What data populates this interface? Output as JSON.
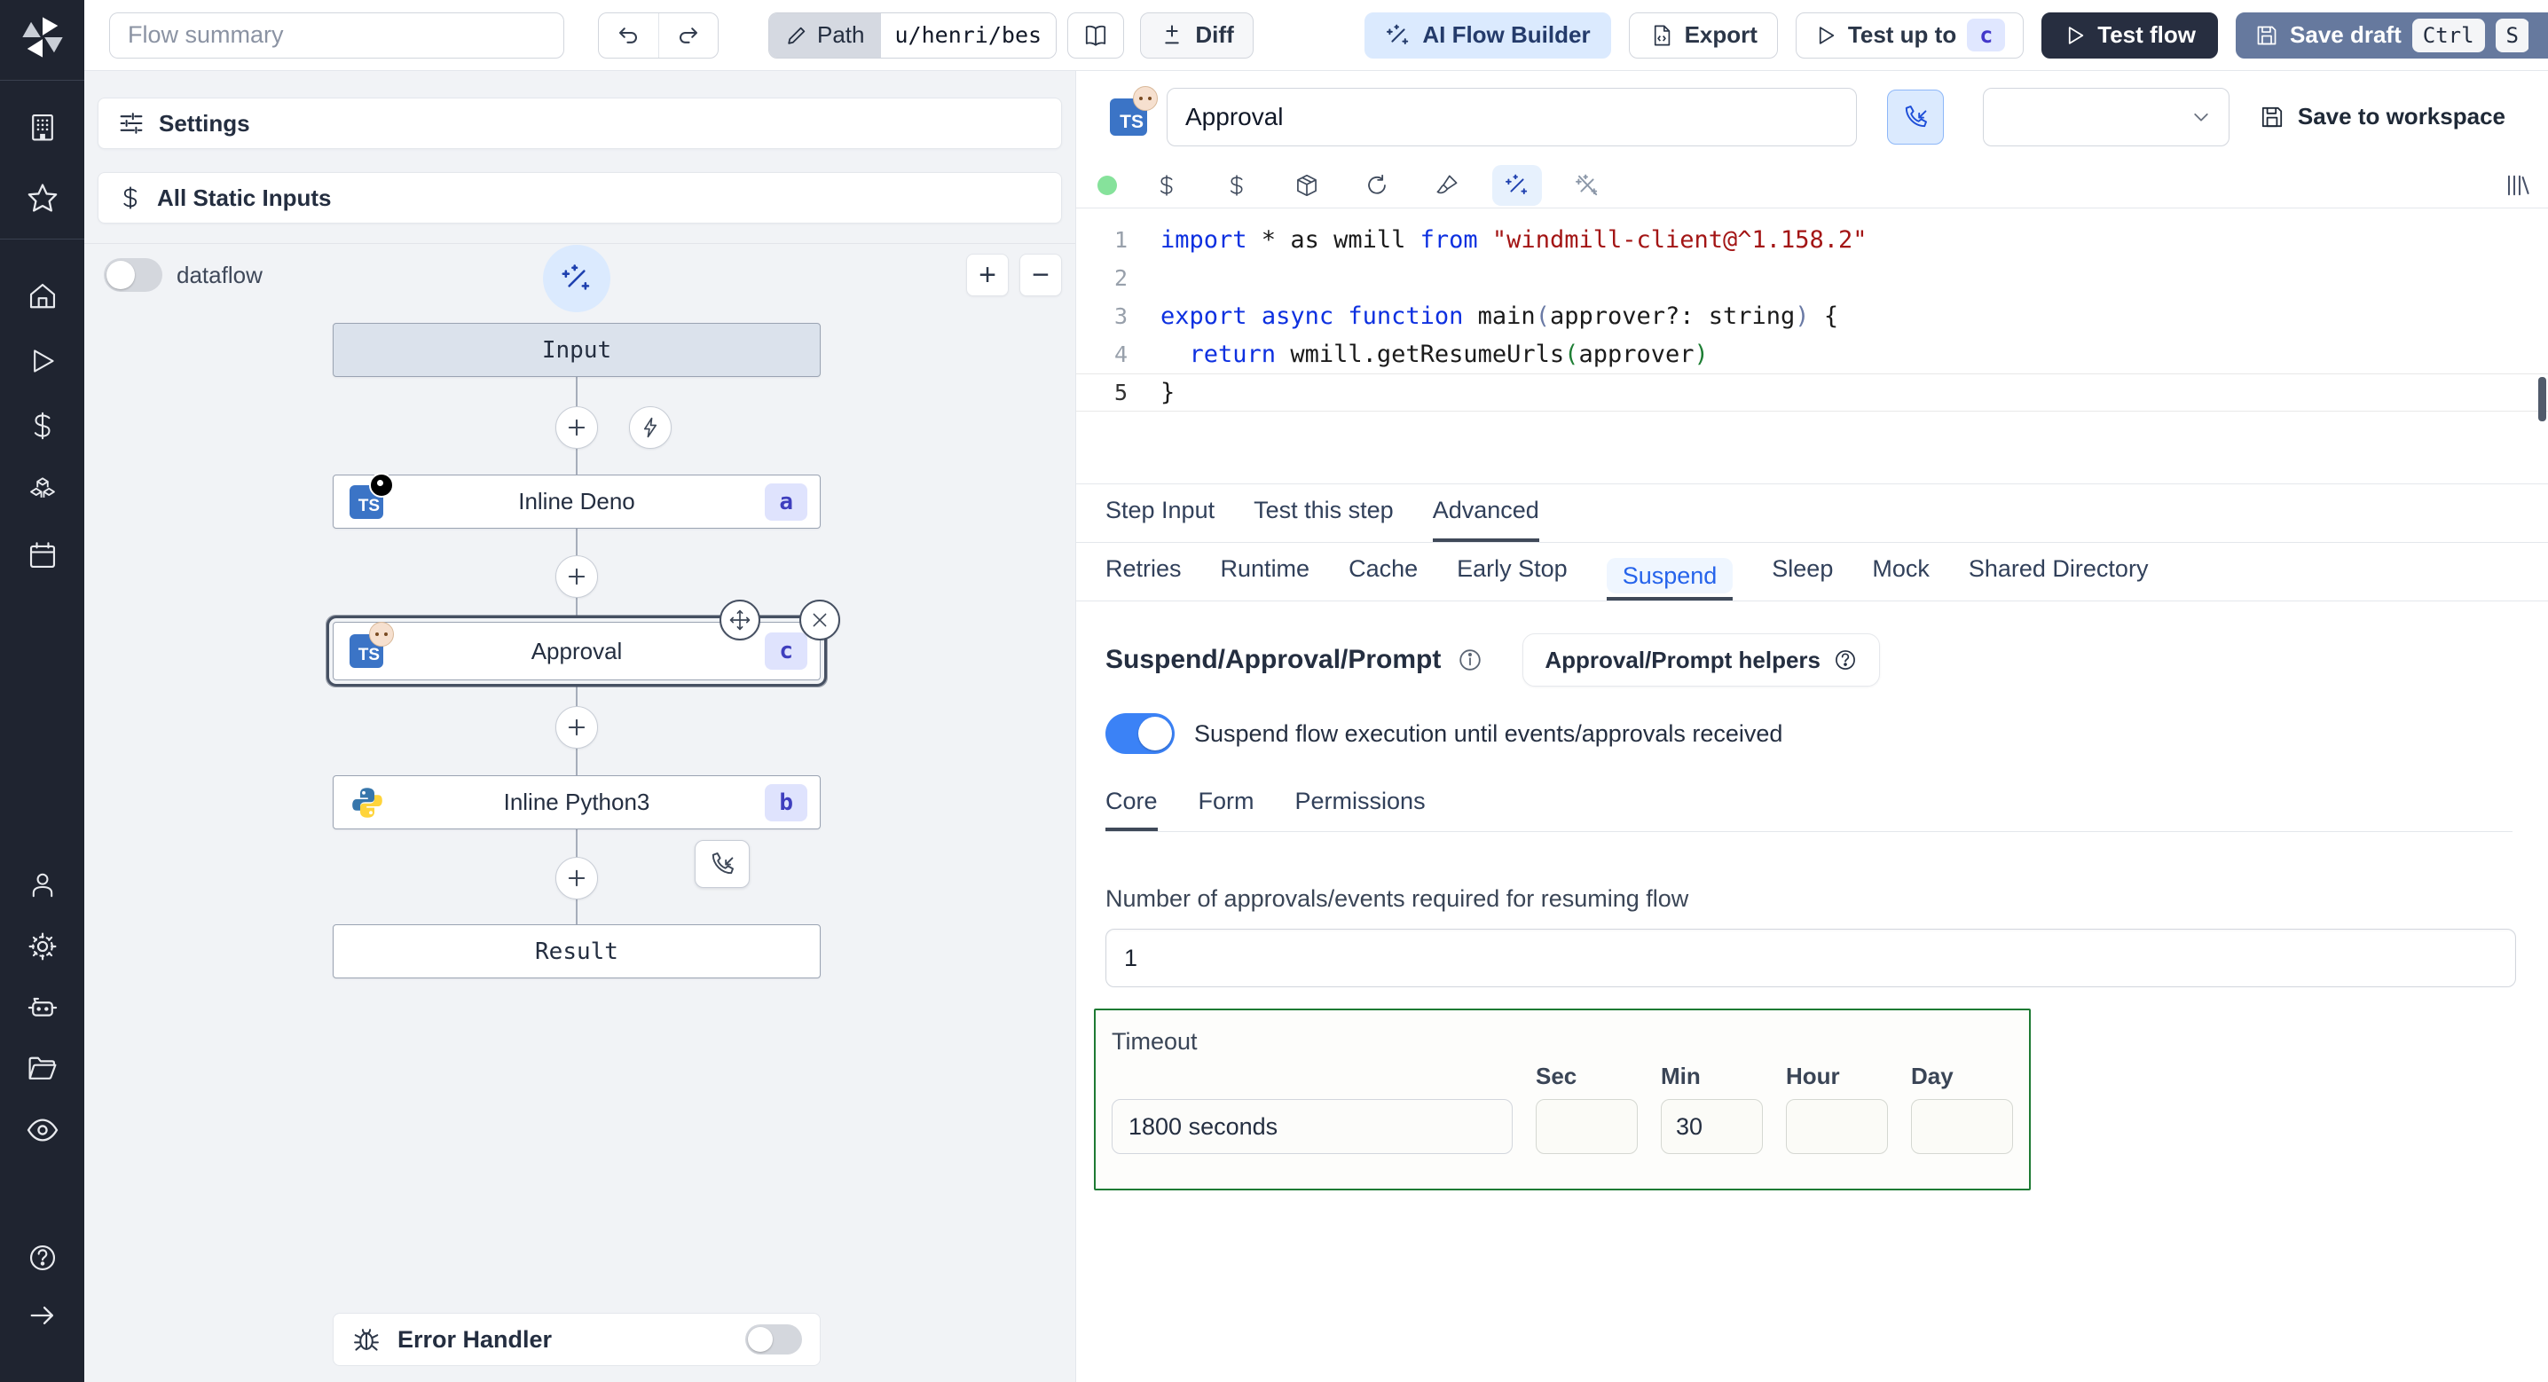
{
  "topbar": {
    "flow_summary_placeholder": "Flow summary",
    "path_button": "Path",
    "path_value": "u/henri/bes",
    "diff_label": "Diff",
    "ai_flow_builder_label": "AI Flow Builder",
    "export_label": "Export",
    "test_up_to_label": "Test up to",
    "test_up_to_badge": "c",
    "test_flow_label": "Test flow",
    "save_draft_label": "Save draft",
    "kbd_ctrl": "Ctrl",
    "kbd_s": "S"
  },
  "flow_panel": {
    "settings_label": "Settings",
    "all_static_inputs_label": "All Static Inputs",
    "dataflow_label": "dataflow",
    "zoom_in": "+",
    "zoom_out": "−",
    "error_handler_label": "Error Handler"
  },
  "graph": {
    "input_label": "Input",
    "result_label": "Result",
    "steps": [
      {
        "label": "Inline Deno",
        "badge": "a",
        "language": "deno"
      },
      {
        "label": "Approval",
        "badge": "c",
        "language": "bun",
        "selected": true
      },
      {
        "label": "Inline Python3",
        "badge": "b",
        "language": "python3"
      }
    ]
  },
  "step_editor": {
    "name_value": "Approval",
    "save_to_workspace_label": "Save to workspace",
    "code": {
      "line_numbers": [
        "1",
        "2",
        "3",
        "4",
        "5"
      ],
      "lines": [
        [
          {
            "t": "import",
            "c": "kw"
          },
          {
            "t": " * as wmill ",
            "c": "pl"
          },
          {
            "t": "from",
            "c": "kw"
          },
          {
            "t": " ",
            "c": "pl"
          },
          {
            "t": "\"windmill-client@^1.158.2\"",
            "c": "str"
          }
        ],
        [],
        [
          {
            "t": "export",
            "c": "kw"
          },
          {
            "t": " ",
            "c": "pl"
          },
          {
            "t": "async",
            "c": "kw"
          },
          {
            "t": " ",
            "c": "pl"
          },
          {
            "t": "function",
            "c": "kw"
          },
          {
            "t": " main",
            "c": "pl"
          },
          {
            "t": "(",
            "c": "brA"
          },
          {
            "t": "approver?: string",
            "c": "pl"
          },
          {
            "t": ")",
            "c": "brA"
          },
          {
            "t": " {",
            "c": "pl"
          }
        ],
        [
          {
            "t": "  ",
            "c": "pl"
          },
          {
            "t": "return",
            "c": "kw"
          },
          {
            "t": " wmill.getResumeUrls",
            "c": "pl"
          },
          {
            "t": "(",
            "c": "brB"
          },
          {
            "t": "approver",
            "c": "pl"
          },
          {
            "t": ")",
            "c": "brB"
          }
        ],
        [
          {
            "t": "}",
            "c": "pl"
          }
        ]
      ]
    }
  },
  "tabs": {
    "main": [
      "Step Input",
      "Test this step",
      "Advanced"
    ],
    "active_main": "Advanced",
    "advanced": [
      "Retries",
      "Runtime",
      "Cache",
      "Early Stop",
      "Suspend",
      "Sleep",
      "Mock",
      "Shared Directory"
    ],
    "active_advanced": "Suspend"
  },
  "suspend_section": {
    "heading": "Suspend/Approval/Prompt",
    "helpers_button": "Approval/Prompt helpers",
    "toggle_label": "Suspend flow execution until events/approvals received",
    "sub_tabs": [
      "Core",
      "Form",
      "Permissions"
    ],
    "active_sub_tab": "Core",
    "approvals_label": "Number of approvals/events required for resuming flow",
    "approvals_value": "1",
    "timeout": {
      "label": "Timeout",
      "duration_value": "1800 seconds",
      "units": [
        "Sec",
        "Min",
        "Hour",
        "Day"
      ],
      "sec_value": "",
      "min_value": "30",
      "hour_value": "",
      "day_value": ""
    }
  },
  "colors": {
    "accent_blue": "#3b82f6",
    "suspend_tab_text": "#2563eb",
    "save_draft_button": "#66799e",
    "test_flow_button": "#272e40",
    "ai_builder_bg": "#dbeafe",
    "badge_bg": "#dfe3fd",
    "badge_text": "#3f3fbe",
    "timeout_border_green": "#1d7a33",
    "sidebar_bg": "#1f2430",
    "flow_panel_bg": "#f1f3f6",
    "input_node_bg": "#dbe2ec"
  }
}
